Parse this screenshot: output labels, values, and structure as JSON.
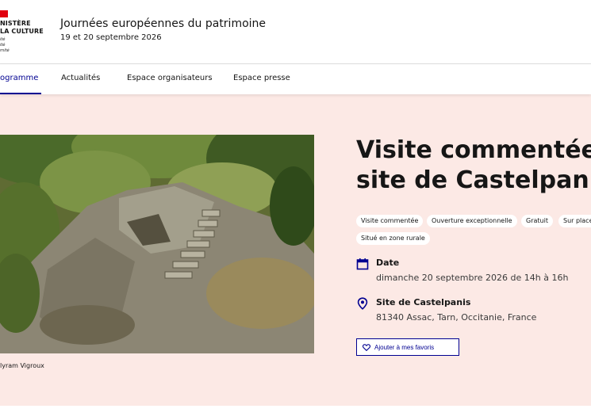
{
  "header": {
    "logo": {
      "line1": "NISTÈRE",
      "line2": "LA CULTURE",
      "motto_lines": [
        "ité",
        "ité",
        "rnité"
      ]
    },
    "site_title": "Journées européennes du patrimoine",
    "site_subtitle": "19 et 20 septembre 2026"
  },
  "nav": {
    "items": [
      {
        "label": "ogramme",
        "active": true
      },
      {
        "label": "Actualités",
        "active": false
      },
      {
        "label": "Espace organisateurs",
        "active": false
      },
      {
        "label": "Espace presse",
        "active": false
      }
    ]
  },
  "event": {
    "title_lines": [
      "Visite commentée",
      "site de Castelpanis"
    ],
    "tags": [
      "Visite commentée",
      "Ouverture exceptionnelle",
      "Gratuit",
      "Sur place",
      "Situé en zone rurale"
    ],
    "photo_caption": "lyram Vigroux",
    "date": {
      "label": "Date",
      "value": "dimanche 20 septembre 2026 de 14h à 16h",
      "icon": "calendar-icon"
    },
    "location": {
      "label": "Site de Castelpanis",
      "value": "81340 Assac, Tarn, Occitanie, France",
      "icon": "map-pin-icon"
    },
    "favorite_button": {
      "label": "Ajouter à mes favoris",
      "icon": "heart-icon"
    }
  },
  "colors": {
    "brand_blue": "#000091",
    "marianne_red": "#e1000f",
    "hero_background": "#fce9e5"
  }
}
